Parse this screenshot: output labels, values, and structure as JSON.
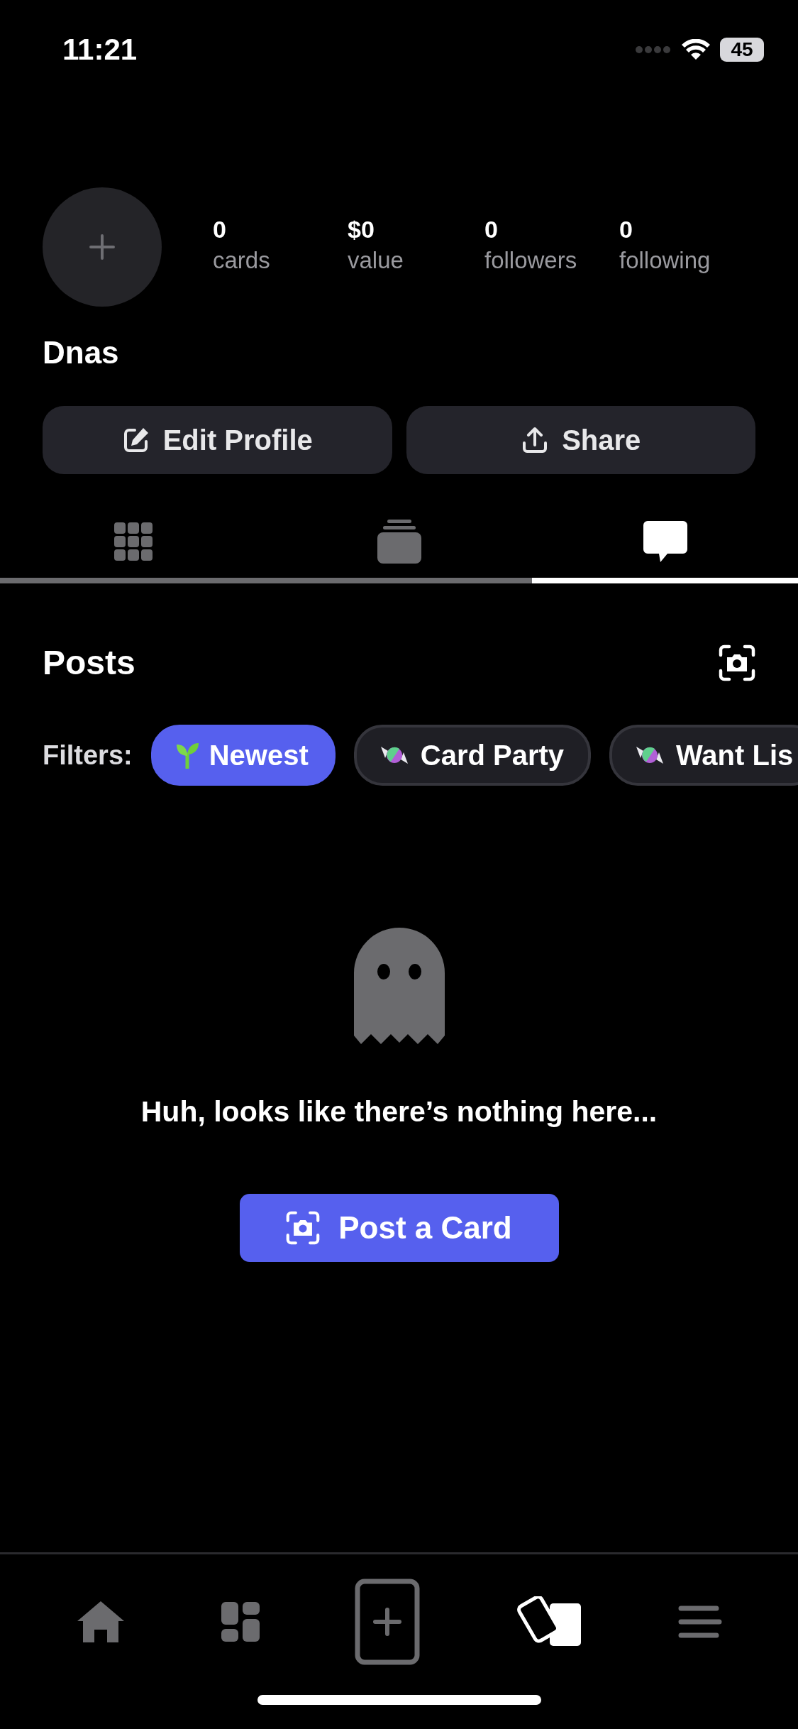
{
  "status_bar": {
    "time": "11:21",
    "battery": "45"
  },
  "profile": {
    "name": "Dnas",
    "stats": [
      {
        "value": "0",
        "label": "cards"
      },
      {
        "value": "$0",
        "label": "value"
      },
      {
        "value": "0",
        "label": "followers"
      },
      {
        "value": "0",
        "label": "following"
      }
    ],
    "buttons": [
      {
        "kind": "edit",
        "label": "Edit Profile"
      },
      {
        "kind": "share",
        "label": "Share"
      }
    ]
  },
  "tabs": [
    {
      "kind": "grid",
      "selected": false
    },
    {
      "kind": "stack",
      "selected": false
    },
    {
      "kind": "chat",
      "selected": true
    }
  ],
  "posts": {
    "title": "Posts",
    "filters_label": "Filters:",
    "filters": [
      {
        "kind": "sprout",
        "label": "Newest",
        "selected": true
      },
      {
        "kind": "candy",
        "label": "Card Party",
        "selected": false
      },
      {
        "kind": "candy",
        "label": "Want Lis",
        "selected": false
      }
    ],
    "empty_message": "Huh, looks like there’s nothing here...",
    "action": "Post a Card"
  },
  "nav": [
    {
      "kind": "home",
      "selected": false
    },
    {
      "kind": "widgets",
      "selected": false
    },
    {
      "kind": "add",
      "selected": false
    },
    {
      "kind": "cards",
      "selected": true
    },
    {
      "kind": "menu",
      "selected": false
    }
  ]
}
